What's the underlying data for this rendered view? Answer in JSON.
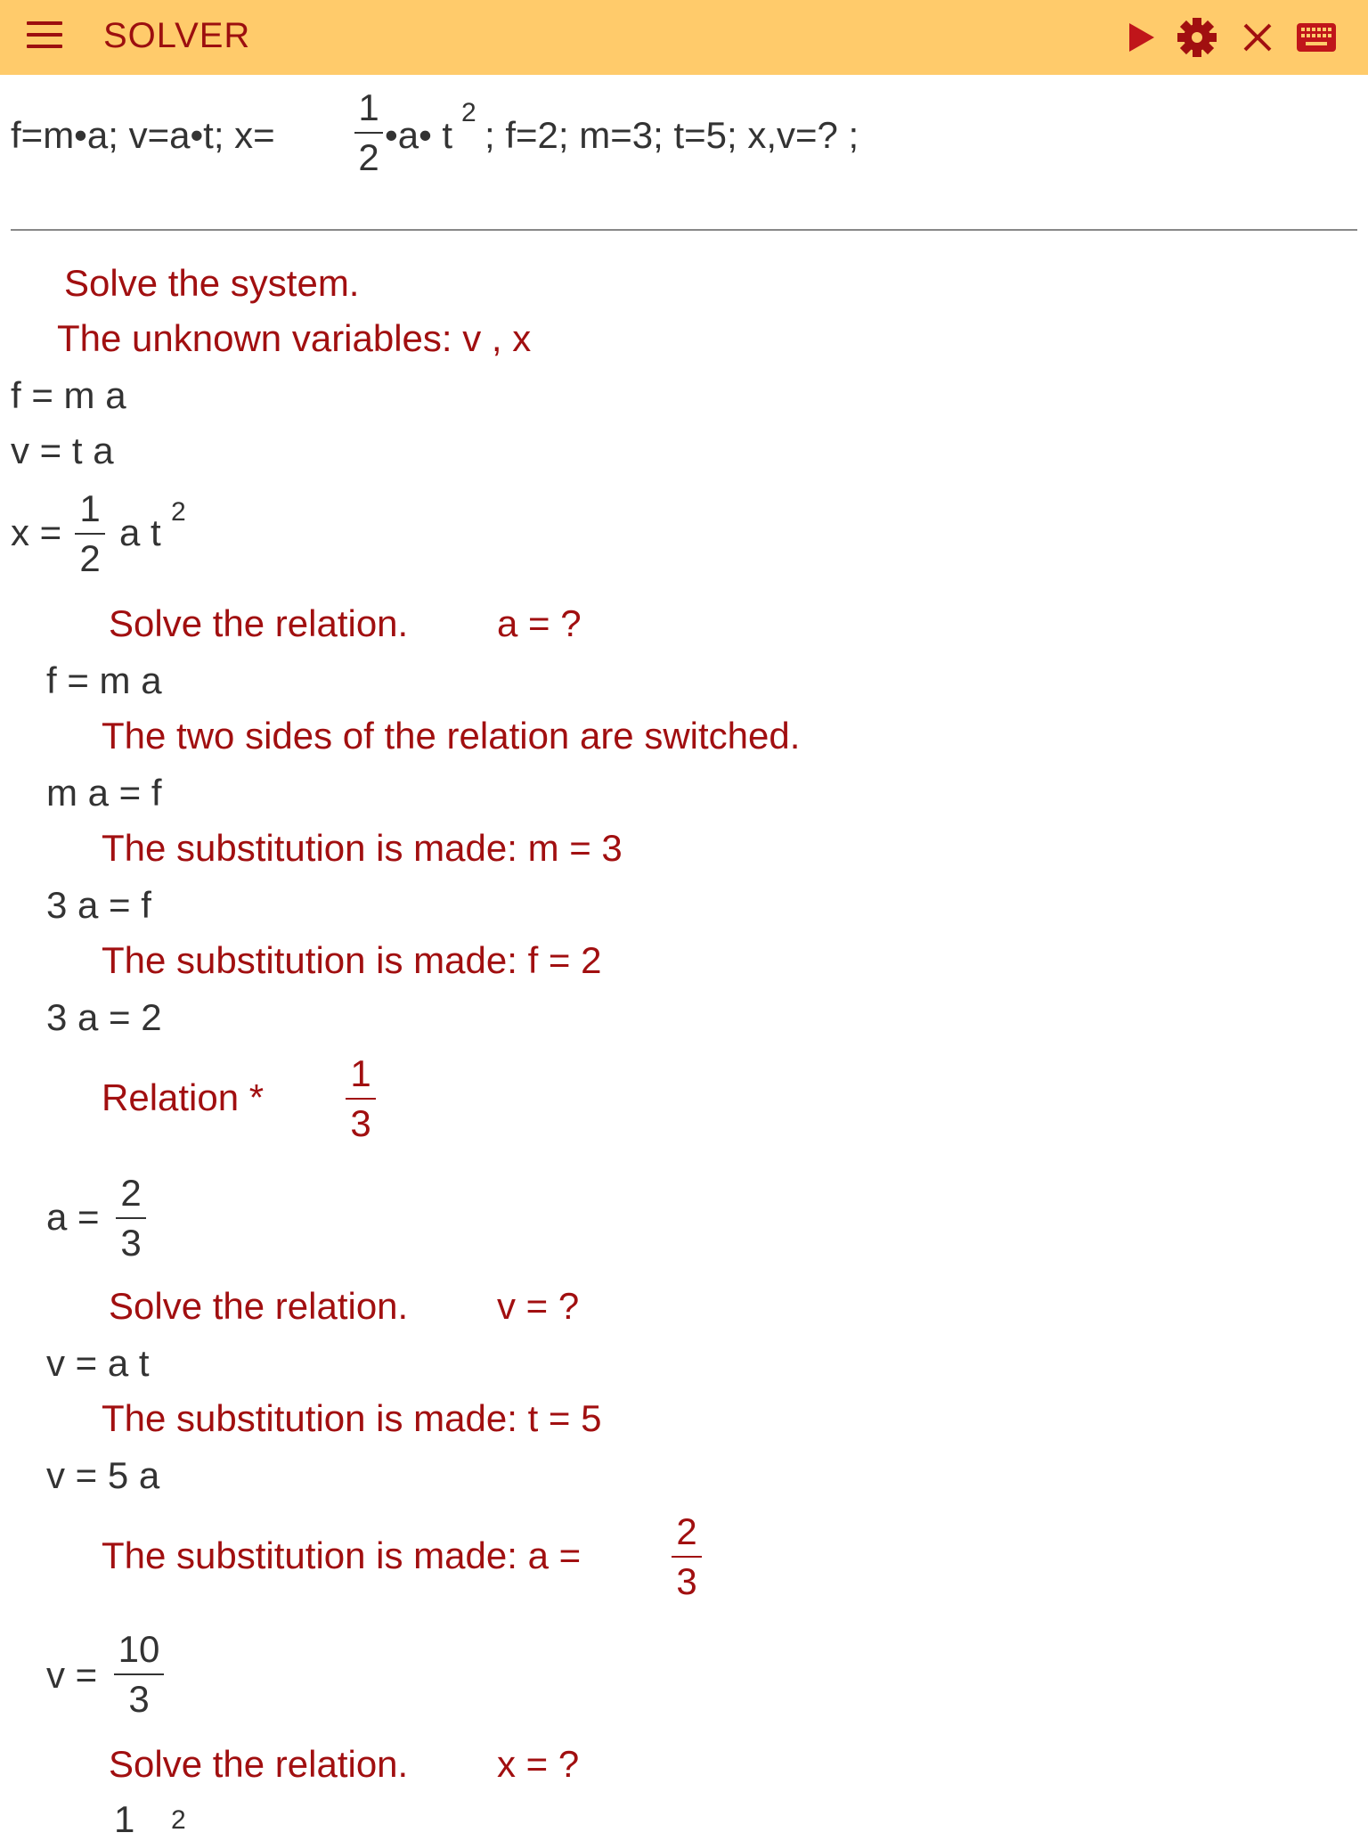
{
  "app": {
    "title": "SOLVER",
    "accent_color": "#FFCB6B",
    "icon_color": "#9c0f0f",
    "toolbar_icons": [
      "menu-icon",
      "play-icon",
      "gear-icon",
      "close-icon",
      "keyboard-icon"
    ]
  },
  "input": {
    "p1": "f=m•a;   v=a•t;   x=",
    "frac_num": "1",
    "frac_den": "2",
    "p2": "•a• t",
    "sup": "2",
    "p3": ";   f=2;  m=3;   t=5;  x,v=? ;"
  },
  "solution": {
    "s1": "Solve the system.",
    "s2": "The unknown variables:  v , x",
    "e1": "f = m a",
    "e2": "v = t a",
    "e3_lhs": "x =",
    "e3_num": "1",
    "e3_den": "2",
    "e3_rhs": "a  t",
    "e3_sup": "2",
    "s3": "Solve the relation.",
    "s3_var": "a    = ?",
    "e4": "f = m a",
    "s4": "The two sides of the relation are switched.",
    "e5": "m a = f",
    "s5": "The substitution is made:  m = 3",
    "e6": "3 a = f",
    "s6": "The substitution is made:  f = 2",
    "e7": "3 a = 2",
    "s7": "Relation *",
    "s7_num": "1",
    "s7_den": "3",
    "e8_lhs": "a =",
    "e8_num": "2",
    "e8_den": "3",
    "s8": "Solve the relation.",
    "s8_var": "v    = ?",
    "e9": "v = a t",
    "s9": "The substitution is made:  t = 5",
    "e10": "v = 5 a",
    "s10": "The substitution is made:  a =",
    "s10_num": "2",
    "s10_den": "3",
    "e11_lhs": "v =",
    "e11_num": "10",
    "e11_den": "3",
    "s11": "Solve the relation.",
    "s11_var": "x    = ?",
    "e12_num": "1",
    "e12_sup": "2"
  }
}
